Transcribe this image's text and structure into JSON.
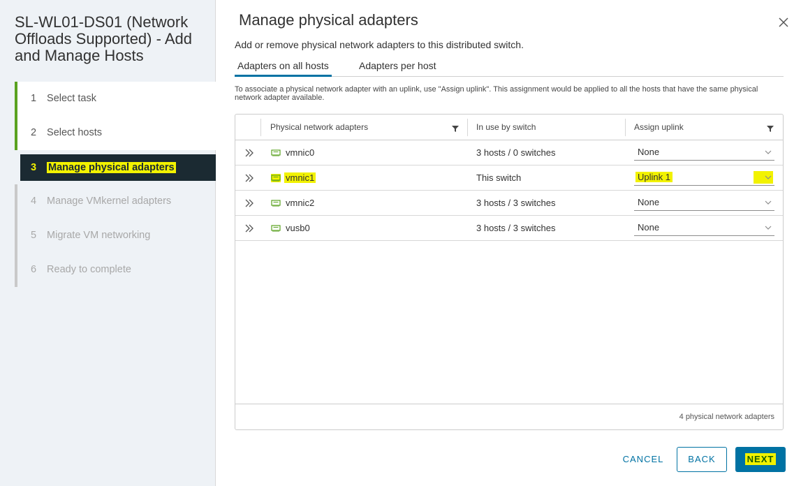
{
  "wizard": {
    "title": "SL-WL01-DS01 (Network Offloads Supported) - Add and Manage Hosts",
    "steps": [
      {
        "num": "1",
        "label": "Select task",
        "state": "done"
      },
      {
        "num": "2",
        "label": "Select hosts",
        "state": "done"
      },
      {
        "num": "3",
        "label": "Manage physical adapters",
        "state": "active"
      },
      {
        "num": "4",
        "label": "Manage VMkernel adapters",
        "state": "todo"
      },
      {
        "num": "5",
        "label": "Migrate VM networking",
        "state": "todo"
      },
      {
        "num": "6",
        "label": "Ready to complete",
        "state": "todo"
      }
    ]
  },
  "dialog": {
    "title": "Manage physical adapters",
    "subtitle": "Add or remove physical network adapters to this distributed switch.",
    "close_icon": "close-icon"
  },
  "tabs": [
    {
      "label": "Adapters on all hosts",
      "active": true
    },
    {
      "label": "Adapters per host",
      "active": false
    }
  ],
  "hint": "To associate a physical network adapter with an uplink, use \"Assign uplink\". This assignment would be applied to all the hosts that have the same physical network adapter available.",
  "grid": {
    "columns": [
      "Physical network adapters",
      "In use by switch",
      "Assign uplink"
    ],
    "rows": [
      {
        "adapter": "vmnic0",
        "in_use": "3 hosts / 0 switches",
        "uplink": "None",
        "highlighted": false
      },
      {
        "adapter": "vmnic1",
        "in_use": "This switch",
        "uplink": "Uplink 1",
        "highlighted": true
      },
      {
        "adapter": "vmnic2",
        "in_use": "3 hosts / 3 switches",
        "uplink": "None",
        "highlighted": false
      },
      {
        "adapter": "vusb0",
        "in_use": "3 hosts / 3 switches",
        "uplink": "None",
        "highlighted": false
      }
    ],
    "footer_count": "4 physical network adapters"
  },
  "buttons": {
    "cancel": "CANCEL",
    "back": "BACK",
    "next": "NEXT"
  },
  "colors": {
    "accent": "#0072a3",
    "highlight": "#f2f200",
    "active_step_bg": "#1b2a32",
    "step_done_bar": "#5aa220",
    "nic_icon": "#5aa220"
  }
}
